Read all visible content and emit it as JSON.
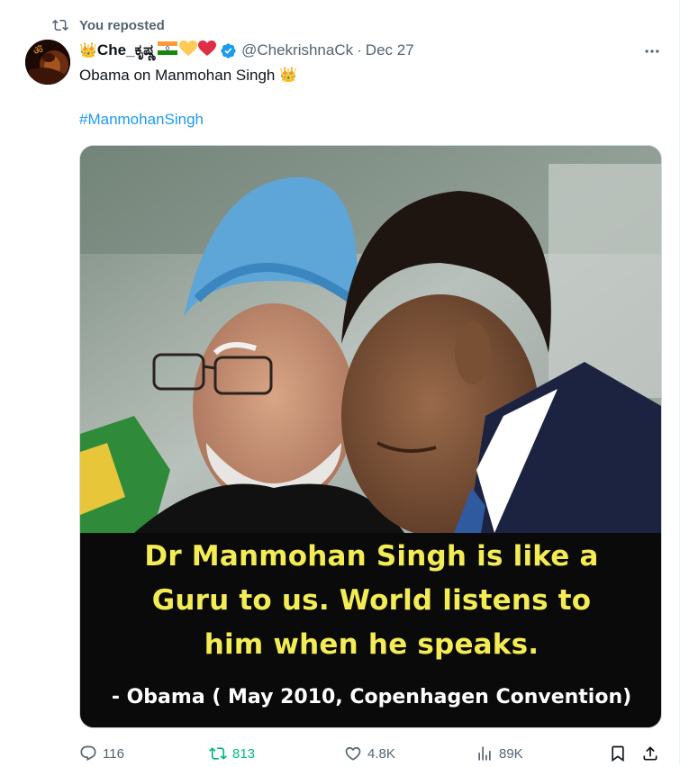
{
  "repost_banner": {
    "text": "You reposted"
  },
  "author": {
    "crown_emoji": "👑",
    "name_text": "Che_ಕೃಷ್ಣ",
    "flag_emoji": "🇮🇳",
    "heart_yellow": "💛",
    "heart_red": "❤️",
    "handle": "@ChekrishnaCk",
    "separator": "·",
    "date": "Dec 27",
    "verified": true
  },
  "tweet": {
    "text": "Obama on Manmohan Singh",
    "text_emoji": "👑",
    "hashtag": "#ManmohanSingh"
  },
  "media": {
    "caption_lines": [
      "Dr Manmohan Singh is like a",
      "Guru to us. World listens to",
      "him when he speaks."
    ],
    "attribution": "- Obama ( May 2010, Copenhagen Convention)",
    "caption_color": "#f3ec55"
  },
  "actions": {
    "reply_count": "116",
    "repost_count": "813",
    "like_count": "4.8K",
    "view_count": "89K"
  },
  "colors": {
    "accent": "#1d9bf0",
    "secondary_text": "#536471",
    "repost_active": "#00ba7c"
  },
  "icons": [
    "repost-icon",
    "verified-badge-icon",
    "more-options-icon",
    "reply-icon",
    "like-icon",
    "views-icon",
    "bookmark-icon",
    "share-icon"
  ]
}
